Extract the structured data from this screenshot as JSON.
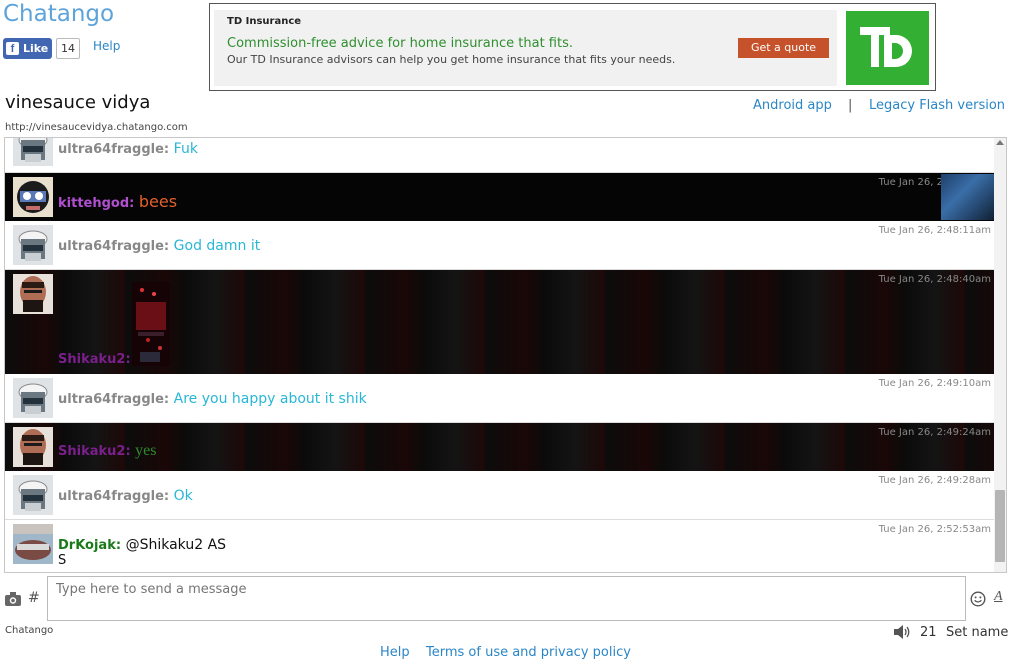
{
  "header": {
    "logo": "Chatango",
    "fb_like": "Like",
    "fb_count": "14",
    "help": "Help",
    "room_title": "vinesauce vidya",
    "room_url": "http://vinesaucevidya.chatango.com",
    "android": "Android app",
    "separator": "|",
    "legacy": "Legacy Flash version"
  },
  "ad": {
    "brand": "TD Insurance",
    "headline": "Commission-free advice for home insurance that fits.",
    "body": "Our TD Insurance advisors can help you get home insurance that fits your needs.",
    "button": "Get a quote",
    "logo_text": "TD"
  },
  "messages": [
    {
      "user": "ultra64fraggle:",
      "text": "Fuk",
      "time": ""
    },
    {
      "user": "kittehgod:",
      "text": "bees",
      "time": "Tue Jan 26, 2:48:01am"
    },
    {
      "user": "ultra64fraggle:",
      "text": "God damn it",
      "time": "Tue Jan 26, 2:48:11am"
    },
    {
      "user": "Shikaku2:",
      "text": "",
      "time": "Tue Jan 26, 2:48:40am"
    },
    {
      "user": "ultra64fraggle:",
      "text": "Are you happy about it shik",
      "time": "Tue Jan 26, 2:49:10am"
    },
    {
      "user": "Shikaku2:",
      "text": "yes",
      "time": "Tue Jan 26, 2:49:24am"
    },
    {
      "user": "ultra64fraggle:",
      "text": "Ok",
      "time": "Tue Jan 26, 2:49:28am"
    },
    {
      "user": "DrKojak:",
      "text": "@Shikaku2 AS",
      "text2": "S",
      "time": "Tue Jan 26, 2:52:53am"
    }
  ],
  "input": {
    "placeholder": "Type here to send a message",
    "hash": "#",
    "font_button": "A"
  },
  "footer": {
    "brand": "Chatango",
    "user_count": "21",
    "set_name": "Set name",
    "help": "Help",
    "terms": "Terms of use and privacy policy"
  },
  "colors": {
    "link": "#2a86c6",
    "logo": "#5ea3d9",
    "ultra64fraggle_name": "#888888",
    "ultra64fraggle_text": "#29b7d6",
    "kittehgod_name": "#b14fd1",
    "kittehgod_text": "#e2612a",
    "shikaku_name": "#7a1f8c",
    "shikaku_text": "#2e8b2e",
    "drkojak_name": "#1a7a1a",
    "td_green": "#33b034"
  }
}
